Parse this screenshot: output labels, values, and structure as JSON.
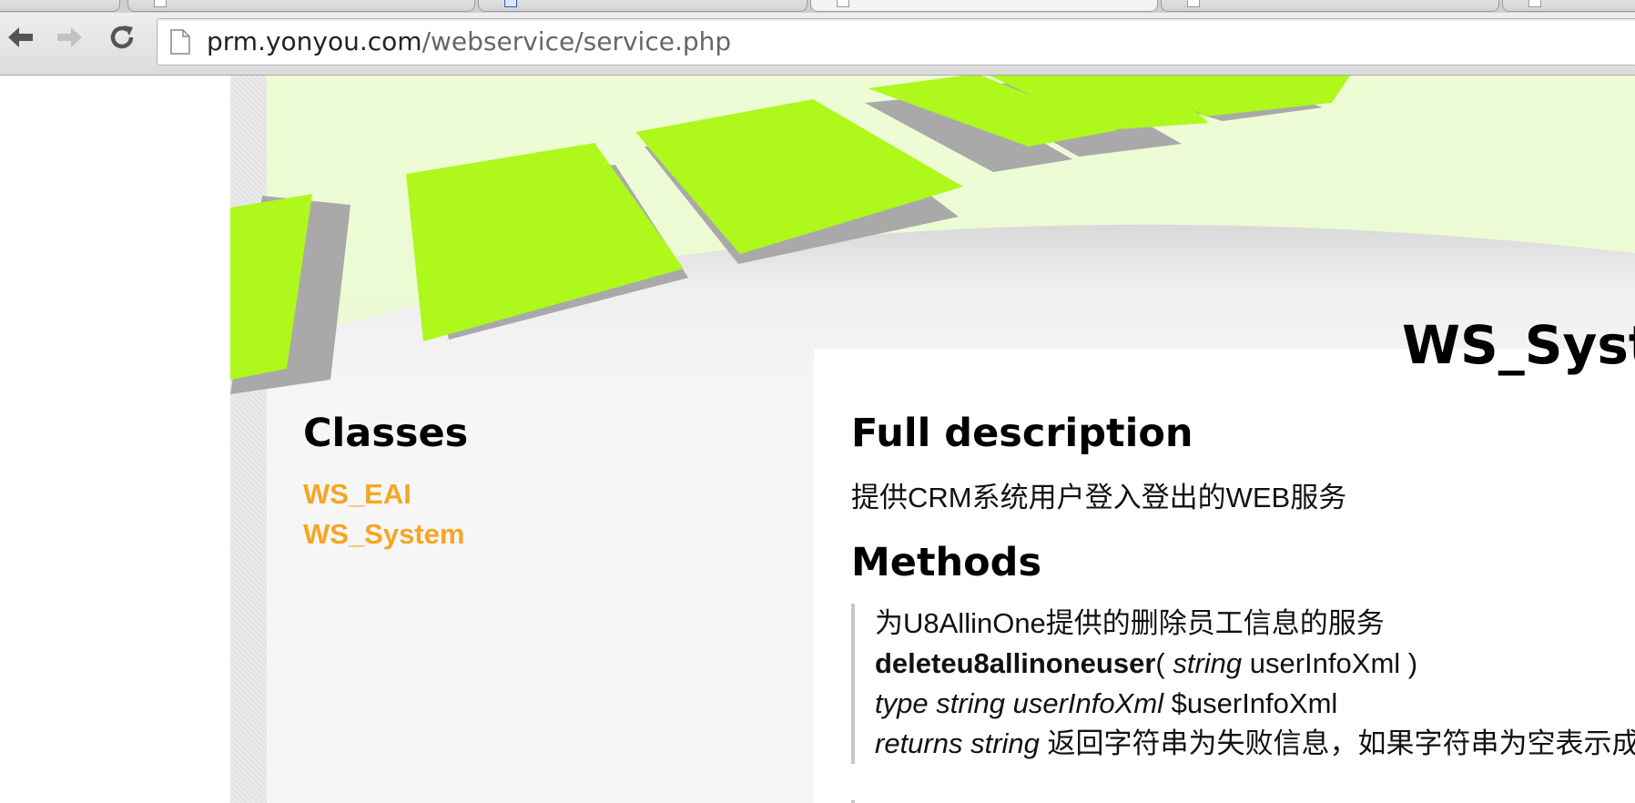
{
  "browser": {
    "url_host": "prm.yonyou.com",
    "url_path": "/webservice/service.php"
  },
  "page": {
    "class_title": "WS_System",
    "sidebar": {
      "heading": "Classes",
      "classes": [
        "WS_EAI",
        "WS_System"
      ]
    },
    "main": {
      "full_description_heading": "Full description",
      "description": "提供CRM系统用户登入登出的WEB服务",
      "methods_heading": "Methods",
      "methods": [
        {
          "summary": "为U8AllinOne提供的删除员工信息的服务",
          "name": "deleteu8allinoneuser",
          "open_paren": "( ",
          "param_type": "string",
          "param_name": " userInfoXml )",
          "type_label": "type string userInfoXml",
          "type_value": " $userInfoXml",
          "returns_label": "returns string",
          "returns_value": " 返回字符串为失败信息，如果字符串为空表示成功"
        }
      ]
    }
  },
  "colors": {
    "link": "#f5a623",
    "accent_green": "#aef81c"
  }
}
